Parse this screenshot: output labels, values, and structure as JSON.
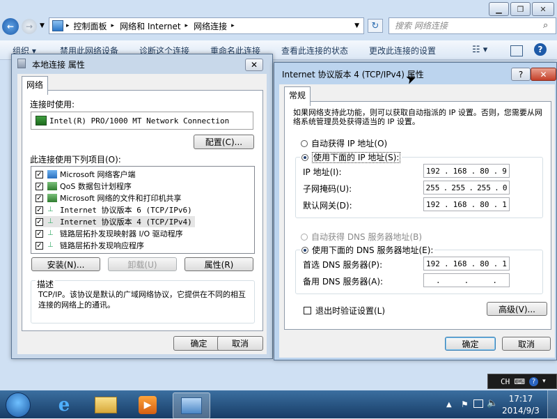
{
  "explorer": {
    "breadcrumbs": [
      "控制面板",
      "网络和 Internet",
      "网络连接"
    ],
    "search_placeholder": "搜索 网络连接",
    "commands": [
      "组织 ▾",
      "禁用此网络设备",
      "诊断这个连接",
      "重命名此连接",
      "查看此连接的状态",
      "更改此连接的设置"
    ]
  },
  "dlg1": {
    "title": "本地连接 属性",
    "tab": "网络",
    "connect_using_label": "连接时使用:",
    "adapter": "Intel(R) PRO/1000 MT Network Connection",
    "configure_button": "配置(C)...",
    "items_label": "此连接使用下列项目(O):",
    "items": [
      {
        "label": "Microsoft 网络客户端",
        "checked": true
      },
      {
        "label": "QoS 数据包计划程序",
        "checked": true
      },
      {
        "label": "Microsoft 网络的文件和打印机共享",
        "checked": true
      },
      {
        "label": "Internet 协议版本 6 (TCP/IPv6)",
        "checked": true
      },
      {
        "label": "Internet 协议版本 4 (TCP/IPv4)",
        "checked": true
      },
      {
        "label": "链路层拓扑发现映射器 I/O 驱动程序",
        "checked": true
      },
      {
        "label": "链路层拓扑发现响应程序",
        "checked": true
      }
    ],
    "install_button": "安装(N)...",
    "uninstall_button": "卸载(U)",
    "properties_button": "属性(R)",
    "description_label": "描述",
    "description_text": "TCP/IP。该协议是默认的广域网络协议，它提供在不同的相互连接的网络上的通讯。",
    "ok_button": "确定",
    "cancel_button": "取消"
  },
  "dlg2": {
    "title": "Internet 协议版本 4 (TCP/IPv4) 属性",
    "help_glyph": "?",
    "tab": "常规",
    "intro": "如果网络支持此功能，则可以获取自动指派的 IP 设置。否则，您需要从网络系统管理员处获得适当的 IP 设置。",
    "auto_ip": "自动获得 IP 地址(O)",
    "manual_ip": "使用下面的 IP 地址(S):",
    "ip_label": "IP 地址(I):",
    "ip": [
      "192",
      "168",
      "80",
      "9"
    ],
    "mask_label": "子网掩码(U):",
    "mask": [
      "255",
      "255",
      "255",
      "0"
    ],
    "gateway_label": "默认网关(D):",
    "gateway": [
      "192",
      "168",
      "80",
      "1"
    ],
    "auto_dns": "自动获得 DNS 服务器地址(B)",
    "manual_dns": "使用下面的 DNS 服务器地址(E):",
    "pref_dns_label": "首选 DNS 服务器(P):",
    "pref_dns": [
      "192",
      "168",
      "80",
      "1"
    ],
    "alt_dns_label": "备用 DNS 服务器(A):",
    "alt_dns": [
      ".",
      ".",
      "."
    ],
    "validate_label": "退出时验证设置(L)",
    "advanced_button": "高级(V)...",
    "ok_button": "确定",
    "cancel_button": "取消"
  },
  "tray": {
    "lang": "CH",
    "time": "17:17",
    "date": "2014/9/3"
  }
}
